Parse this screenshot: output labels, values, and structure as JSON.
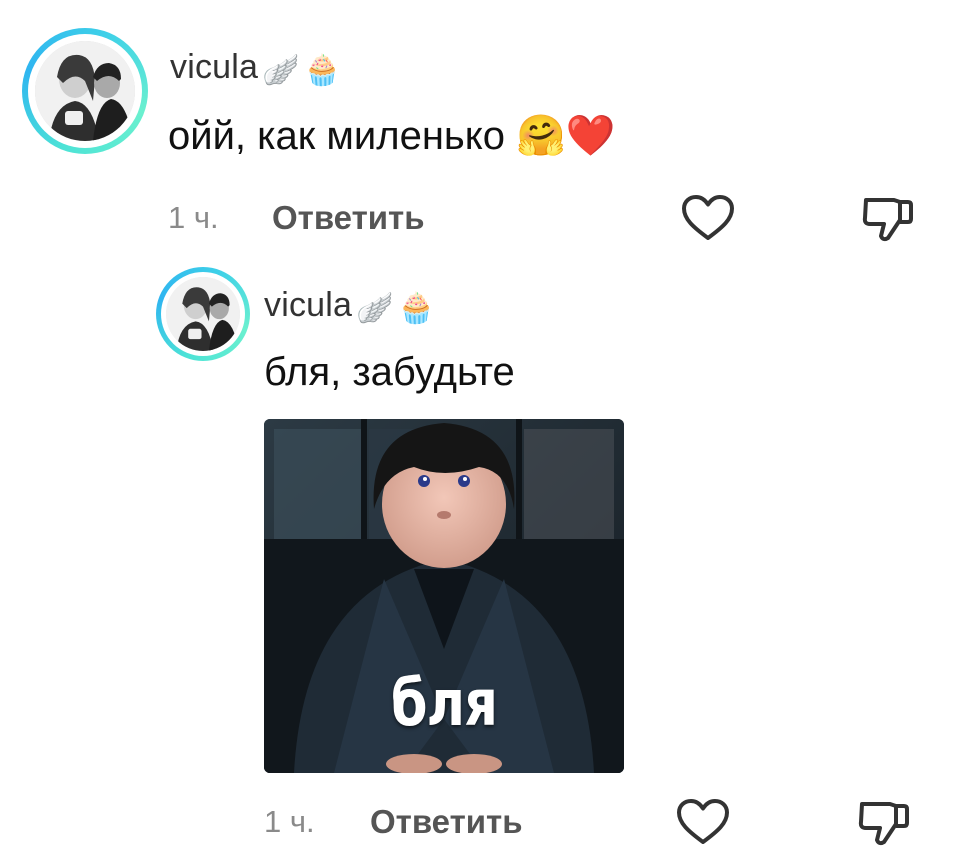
{
  "comments": [
    {
      "username": "vicula",
      "badges": [
        "🪽",
        "🧁"
      ],
      "text": "ойй, как миленько 🤗❤️",
      "time": "1 ч.",
      "reply_label": "Ответить"
    },
    {
      "username": "vicula",
      "badges": [
        "🪽",
        "🧁"
      ],
      "text": "бля, забудьте",
      "gif_caption": "бля",
      "time": "1 ч.",
      "reply_label": "Ответить"
    }
  ],
  "icons": {
    "like": "heart-outline-icon",
    "dislike": "thumbs-down-icon"
  },
  "colors": {
    "avatar_ring": "#3ed0e8",
    "time_text": "#8a8a8a",
    "reply_text": "#555555",
    "icon_stroke": "#333333"
  }
}
